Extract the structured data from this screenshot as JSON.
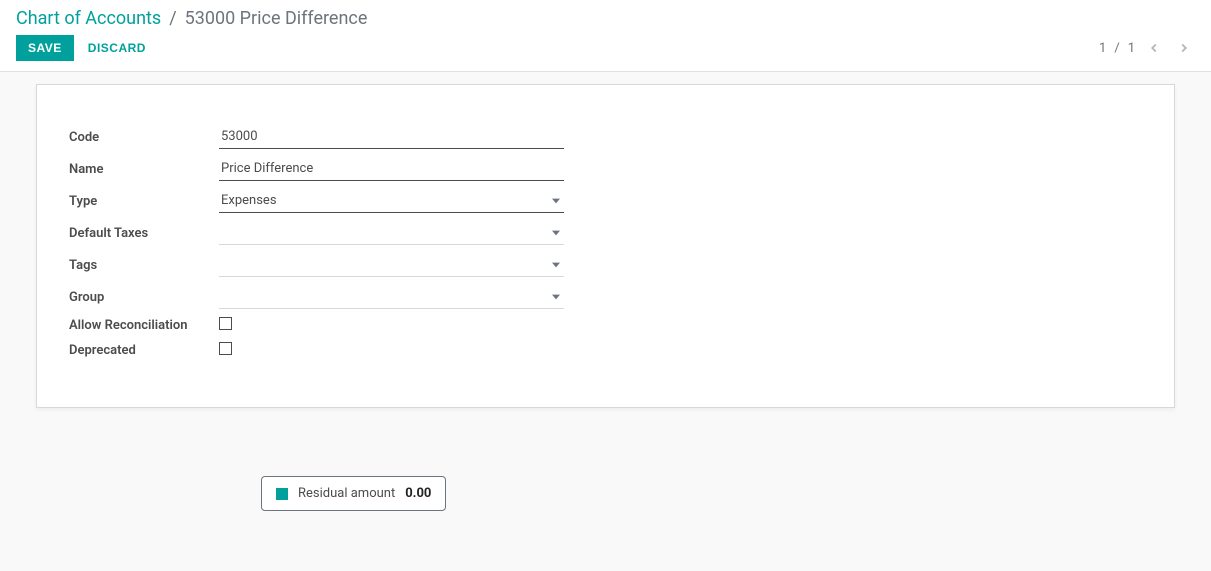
{
  "colors": {
    "accent": "#00a09d"
  },
  "breadcrumb": {
    "root": "Chart of Accounts",
    "current": "53000 Price Difference"
  },
  "actions": {
    "save": "SAVE",
    "discard": "DISCARD"
  },
  "pager": {
    "current": "1",
    "sep": "/",
    "total": "1"
  },
  "form": {
    "labels": {
      "code": "Code",
      "name": "Name",
      "type": "Type",
      "default_taxes": "Default Taxes",
      "tags": "Tags",
      "group": "Group",
      "allow_reconciliation": "Allow Reconciliation",
      "deprecated": "Deprecated"
    },
    "values": {
      "code": "53000",
      "name": "Price Difference",
      "type": "Expenses",
      "default_taxes": "",
      "tags": "",
      "group": "",
      "allow_reconciliation": false,
      "deprecated": false
    }
  },
  "legend": {
    "label": "Residual amount",
    "value": "0.00"
  }
}
